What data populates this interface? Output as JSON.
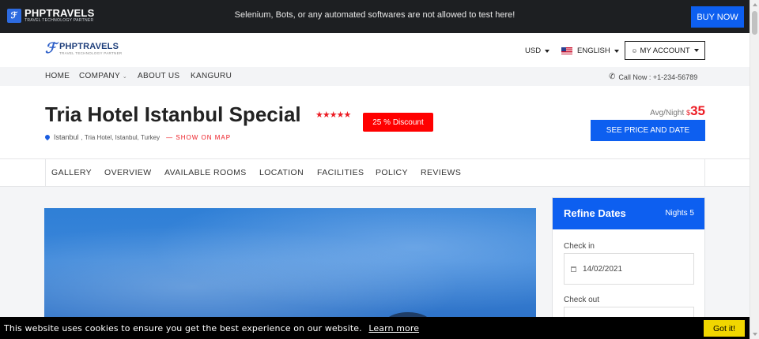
{
  "topbar": {
    "brand": "PHPTRAVELS",
    "brand_tagline": "TRAVEL TECHNOLOGY PARTNER",
    "notice": "Selenium, Bots, or any automated softwares are not allowed to test here!",
    "buy_now": "BUY NOW"
  },
  "header": {
    "brand": "PHPTRAVELS",
    "brand_tagline": "TRAVEL TECHNOLOGY PARTNER",
    "currency": "USD",
    "language": "ENGLISH",
    "account": "MY ACCOUNT"
  },
  "nav": {
    "items": [
      "HOME",
      "COMPANY",
      "ABOUT US",
      "KANGURU"
    ],
    "call": "Call Now : +1-234-56789"
  },
  "hotel": {
    "title": "Tria Hotel Istanbul Special",
    "stars": "★★★★★",
    "discount": "25 % Discount",
    "city": "Istanbul",
    "address": ", Tria Hotel, Istanbul, Turkey",
    "show_on_map": "SHOW ON MAP",
    "avg_label": "Avg/Night",
    "currency_symbol": "$",
    "price": "35",
    "see_price": "SEE PRICE AND DATE"
  },
  "tabs": [
    "GALLERY",
    "OVERVIEW",
    "AVAILABLE ROOMS",
    "LOCATION",
    "FACILITIES",
    "POLICY",
    "REVIEWS"
  ],
  "refine": {
    "title": "Refine Dates",
    "nights": "Nights 5",
    "checkin_label": "Check in",
    "checkin_value": "14/02/2021",
    "checkout_label": "Check out"
  },
  "cookie": {
    "message": "This website uses cookies to ensure you get the best experience on our website.",
    "learn_more": "Learn more",
    "ok": "Got it!"
  },
  "colors": {
    "primary": "#0d5ff0",
    "accent_red": "#ec1c24",
    "dark_bar": "#1d1f22",
    "cookie_button": "#f1d600"
  }
}
